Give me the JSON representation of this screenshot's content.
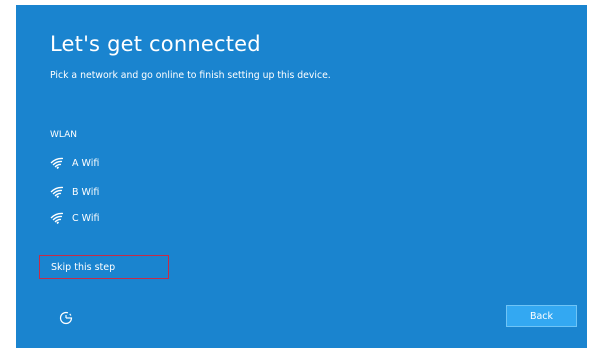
{
  "colors": {
    "background": "#1a84cf",
    "text": "#ffffff",
    "back_button": "#33a8f2",
    "highlight_border": "#c62c47"
  },
  "header": {
    "title": "Let's get connected",
    "subtitle": "Pick a network and go online to finish setting up this device."
  },
  "wlan": {
    "heading": "WLAN",
    "networks": [
      {
        "name": "A Wifi",
        "icon": "wifi-signal-icon"
      },
      {
        "name": "B Wifi",
        "icon": "wifi-signal-icon"
      },
      {
        "name": "C Wifi",
        "icon": "wifi-signal-icon"
      }
    ]
  },
  "footer": {
    "skip_label": "Skip this step",
    "accessibility_icon": "ease-of-access-icon",
    "back_label": "Back"
  }
}
